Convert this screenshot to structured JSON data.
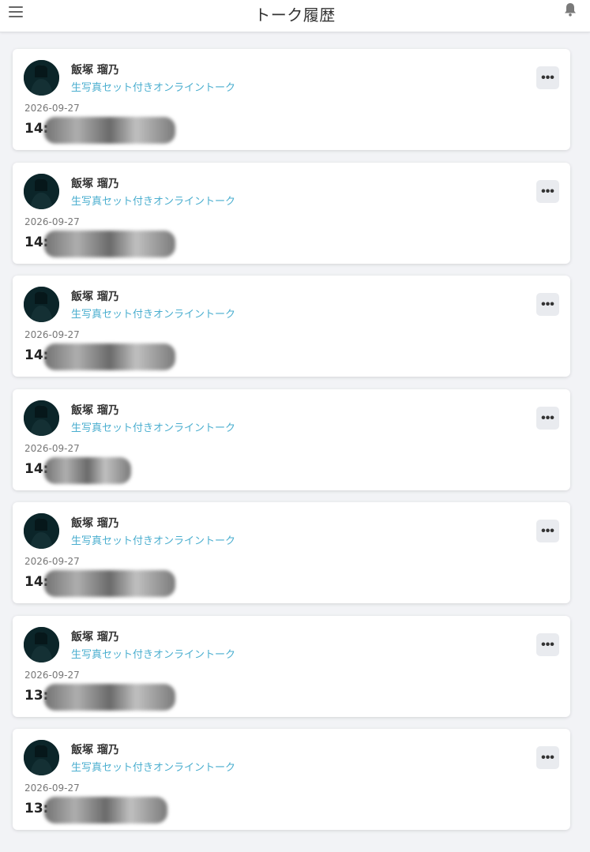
{
  "header": {
    "title": "トーク履歴",
    "menu_icon": "hamburger-menu-icon",
    "bell_icon": "bell-icon"
  },
  "colors": {
    "accent": "#4aaecf",
    "background": "#f2f3f6",
    "card": "#ffffff"
  },
  "talks": [
    {
      "name": "飯塚 瑠乃",
      "type": "生写真セット付きオンライントーク",
      "date": "2026-09-27",
      "time": "14:",
      "more": "•••"
    },
    {
      "name": "飯塚 瑠乃",
      "type": "生写真セット付きオンライントーク",
      "date": "2026-09-27",
      "time": "14:",
      "more": "•••"
    },
    {
      "name": "飯塚 瑠乃",
      "type": "生写真セット付きオンライントーク",
      "date": "2026-09-27",
      "time": "14:",
      "more": "•••"
    },
    {
      "name": "飯塚 瑠乃",
      "type": "生写真セット付きオンライントーク",
      "date": "2026-09-27",
      "time": "14:",
      "more": "•••"
    },
    {
      "name": "飯塚 瑠乃",
      "type": "生写真セット付きオンライントーク",
      "date": "2026-09-27",
      "time": "14:",
      "more": "•••"
    },
    {
      "name": "飯塚 瑠乃",
      "type": "生写真セット付きオンライントーク",
      "date": "2026-09-27",
      "time": "13:",
      "more": "•••"
    },
    {
      "name": "飯塚 瑠乃",
      "type": "生写真セット付きオンライントーク",
      "date": "2026-09-27",
      "time": "13:",
      "more": "•••"
    }
  ]
}
